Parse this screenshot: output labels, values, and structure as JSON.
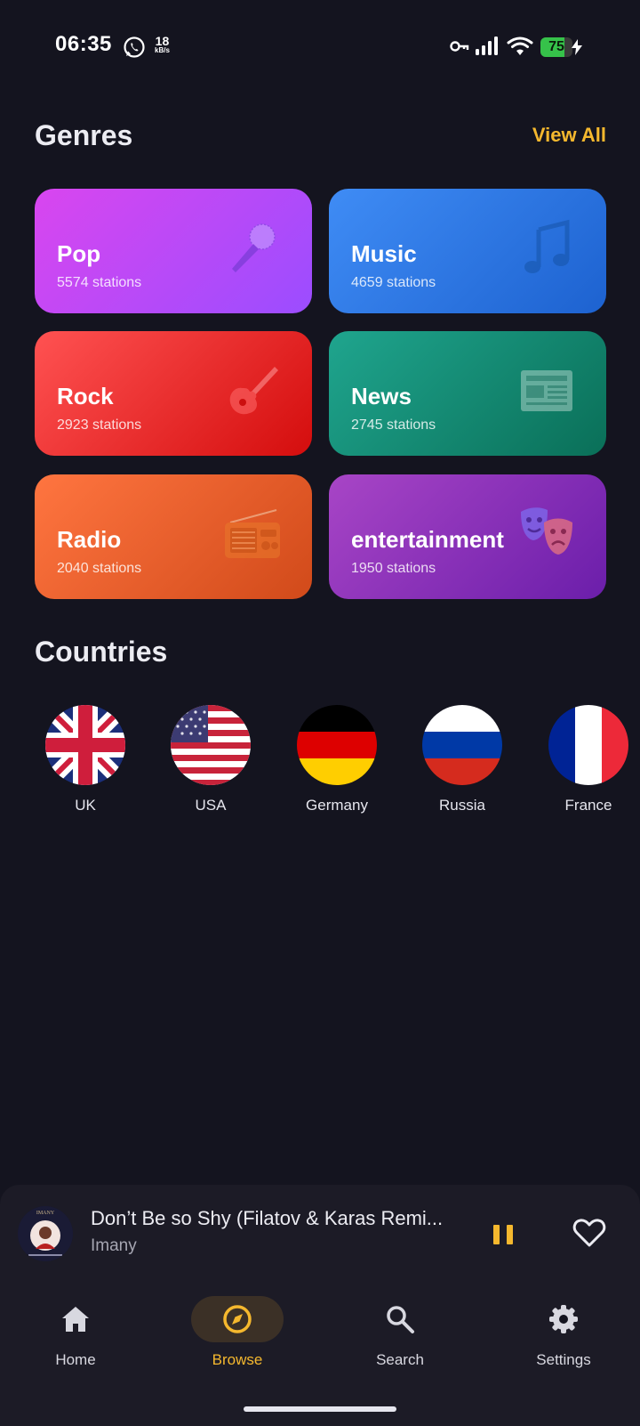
{
  "status_bar": {
    "time": "06:35",
    "net_speed_value": "18",
    "net_speed_unit": "kB/s",
    "battery_level": "75",
    "icons": [
      "whatsapp-icon",
      "key-icon",
      "signal-icon",
      "wifi-icon",
      "battery-icon",
      "charging-bolt-icon"
    ]
  },
  "genres": {
    "title": "Genres",
    "view_all_label": "View All",
    "items": [
      {
        "name": "Pop",
        "count": "5574 stations",
        "icon": "microphone-icon",
        "colors": [
          "#d946ef",
          "#9b4dff"
        ]
      },
      {
        "name": "Music",
        "count": "4659 stations",
        "icon": "music-note-icon",
        "colors": [
          "#3f8cf5",
          "#1d62d0"
        ]
      },
      {
        "name": "Rock",
        "count": "2923 stations",
        "icon": "guitar-icon",
        "colors": [
          "#ff5252",
          "#d40d0d"
        ]
      },
      {
        "name": "News",
        "count": "2745 stations",
        "icon": "newspaper-icon",
        "colors": [
          "#1fa58e",
          "#0a6f58"
        ]
      },
      {
        "name": "Radio",
        "count": "2040 stations",
        "icon": "radio-icon",
        "colors": [
          "#ff7540",
          "#d14a1a"
        ]
      },
      {
        "name": "entertainment",
        "count": "1950 stations",
        "icon": "theater-masks-icon",
        "colors": [
          "#a845c6",
          "#6b1eaa"
        ]
      }
    ]
  },
  "countries": {
    "title": "Countries",
    "items": [
      {
        "name": "UK",
        "flag": "uk-flag"
      },
      {
        "name": "USA",
        "flag": "usa-flag"
      },
      {
        "name": "Germany",
        "flag": "germany-flag"
      },
      {
        "name": "Russia",
        "flag": "russia-flag"
      },
      {
        "name": "France",
        "flag": "france-flag"
      }
    ]
  },
  "player": {
    "track_title": "Don’t Be so Shy (Filatov & Karas Remi...",
    "artist": "Imany",
    "album_art_text": "IMANY",
    "state": "playing"
  },
  "nav": {
    "items": [
      {
        "label": "Home",
        "icon": "home-icon",
        "active": false
      },
      {
        "label": "Browse",
        "icon": "compass-icon",
        "active": true
      },
      {
        "label": "Search",
        "icon": "search-icon",
        "active": false
      },
      {
        "label": "Settings",
        "icon": "gear-icon",
        "active": false
      }
    ]
  },
  "colors": {
    "background": "#14141f",
    "accent": "#f5b82e",
    "player_background": "#1c1b26"
  }
}
